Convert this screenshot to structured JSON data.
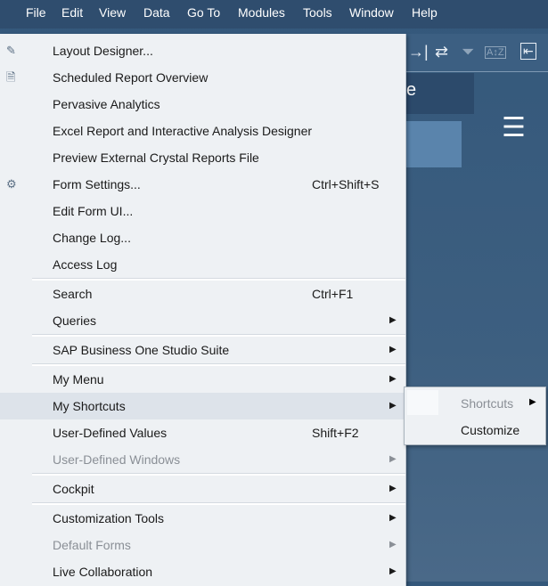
{
  "menubar": [
    "File",
    "Edit",
    "View",
    "Data",
    "Go To",
    "Modules",
    "Tools",
    "Window",
    "Help"
  ],
  "toolbar_icons": [
    "→|",
    "⇄",
    "⏷",
    "A↕Z",
    "⇤"
  ],
  "background": {
    "partial_text": "e"
  },
  "menu": [
    {
      "label": "Layout Designer...",
      "icon": "pencil-icon"
    },
    {
      "label": "Scheduled Report Overview",
      "icon": "report-clock-icon"
    },
    {
      "label": "Pervasive Analytics"
    },
    {
      "label": "Excel Report and Interactive Analysis Designer"
    },
    {
      "label": "Preview External Crystal Reports File"
    },
    {
      "label": "Form Settings...",
      "shortcut": "Ctrl+Shift+S",
      "icon": "form-settings-icon"
    },
    {
      "label": "Edit Form UI..."
    },
    {
      "label": "Change Log..."
    },
    {
      "label": "Access Log"
    },
    {
      "label": "Search",
      "shortcut": "Ctrl+F1"
    },
    {
      "label": "Queries",
      "submenu": true
    },
    {
      "label": "SAP Business One Studio Suite",
      "submenu": true
    },
    {
      "label": "My Menu",
      "submenu": true
    },
    {
      "label": "My Shortcuts",
      "submenu": true
    },
    {
      "label": "User-Defined Values",
      "shortcut": "Shift+F2"
    },
    {
      "label": "User-Defined Windows",
      "submenu": true,
      "disabled": true
    },
    {
      "label": "Cockpit",
      "submenu": true
    },
    {
      "label": "Customization Tools",
      "submenu": true
    },
    {
      "label": "Default Forms",
      "submenu": true,
      "disabled": true
    },
    {
      "label": "Live Collaboration",
      "submenu": true
    }
  ],
  "submenu": {
    "shortcuts": "Shortcuts",
    "customize": "Customize"
  }
}
